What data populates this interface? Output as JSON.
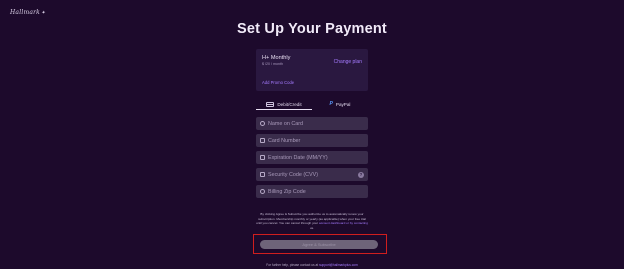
{
  "brand": {
    "logo_text": "Hallmark",
    "crown": "✦"
  },
  "page": {
    "title": "Set Up Your Payment"
  },
  "plan": {
    "name": "H+ Monthly",
    "price": "$ /20 / month",
    "change_label": "Change plan",
    "promo_label": "Add Promo Code"
  },
  "tabs": [
    {
      "label": "Debit/Credit",
      "icon": "credit-card-icon",
      "active": true
    },
    {
      "label": "PayPal",
      "icon": "paypal-icon",
      "active": false
    }
  ],
  "fields": {
    "name_on_card": {
      "placeholder": "Name on Card",
      "icon": "person-icon"
    },
    "card_number": {
      "placeholder": "Card Number",
      "icon": "card-icon"
    },
    "expiration": {
      "placeholder": "Expiration Date (MM/YY)",
      "icon": "calendar-icon"
    },
    "security_code": {
      "placeholder": "Security Code (CVV)",
      "icon": "lock-icon",
      "help": "?"
    },
    "zip": {
      "placeholder": "Billing Zip Code",
      "icon": "location-icon"
    }
  },
  "consent": {
    "text": "By clicking Agree & Subscribe you authorize us to automatically renew your subscription. Membership monthly or yearly (as applicable) when your free trial until you cancel. You can cancel through your",
    "link": "account dashboard or by contacting",
    "suffix": "us."
  },
  "cta": {
    "label": "Agree & Subscribe"
  },
  "footer": {
    "text": "For further help, please contact us at",
    "link": "support@hallmarkplus.com"
  }
}
